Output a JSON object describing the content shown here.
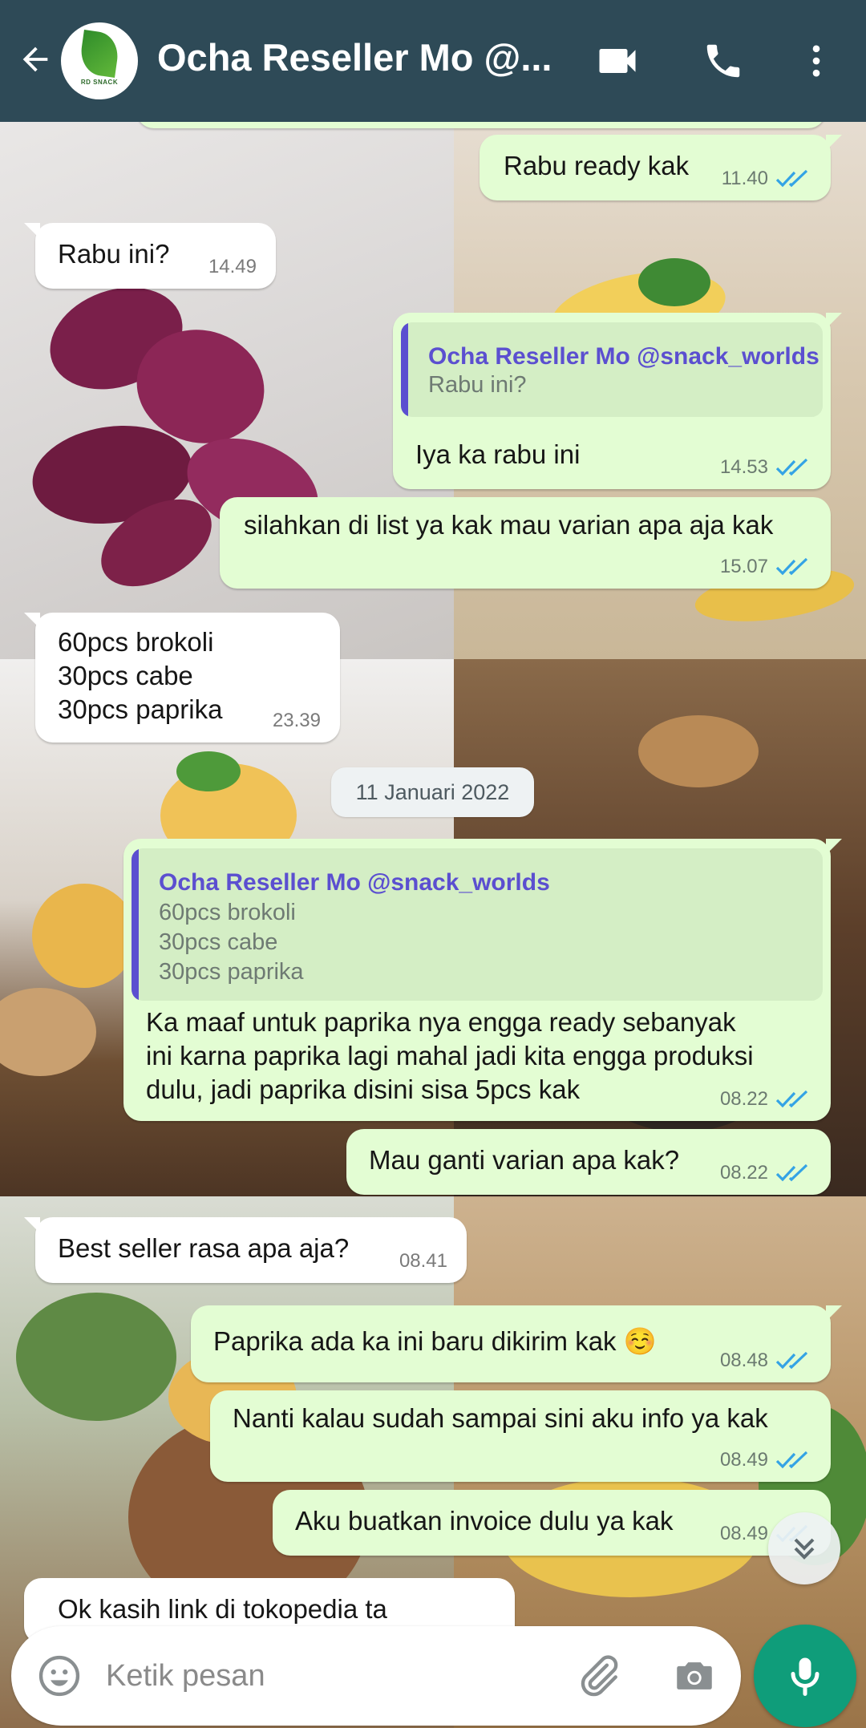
{
  "header": {
    "title": "Ocha Reseller Mo @...",
    "avatar_text": "RD SNACK"
  },
  "messages": [
    {
      "text": "Rabu ready kak",
      "time": "11.40",
      "direction": "out"
    },
    {
      "text": "Rabu ini?",
      "time": "14.49",
      "direction": "in"
    },
    {
      "quote_name": "Ocha Reseller Mo @snack_worlds",
      "quote_text": "Rabu ini?",
      "text": "Iya ka rabu ini",
      "time": "14.53",
      "direction": "out"
    },
    {
      "text": "silahkan di list ya kak mau varian apa aja kak",
      "time": "15.07",
      "direction": "out"
    },
    {
      "text": "60pcs brokoli\n30pcs cabe\n30pcs paprika",
      "time": "23.39",
      "direction": "in"
    },
    {
      "quote_name": "Ocha Reseller Mo @snack_worlds",
      "quote_text": "60pcs brokoli\n30pcs cabe\n30pcs paprika",
      "text": "Ka maaf untuk paprika nya engga ready sebanyak\nini karna paprika lagi mahal jadi kita engga produksi\ndulu, jadi paprika disini sisa 5pcs kak",
      "time": "08.22",
      "direction": "out"
    },
    {
      "text": "Mau ganti varian apa kak?",
      "time": "08.22",
      "direction": "out"
    },
    {
      "text": "Best seller rasa apa aja?",
      "time": "08.41",
      "direction": "in"
    },
    {
      "text": "Paprika ada ka ini baru dikirim kak ☺️",
      "time": "08.48",
      "direction": "out"
    },
    {
      "text": "Nanti kalau sudah sampai sini aku info ya kak",
      "time": "08.49",
      "direction": "out"
    },
    {
      "text": "Aku buatkan invoice dulu ya kak",
      "time": "08.49",
      "direction": "out"
    },
    {
      "text": "Ok kasih link di tokopedia ta",
      "time": "",
      "direction": "in"
    }
  ],
  "date_separator": "11 Januari 2022",
  "input": {
    "placeholder": "Ketik pesan"
  },
  "icons": {
    "back": "back-arrow-icon",
    "video": "video-call-icon",
    "phone": "voice-call-icon",
    "menu": "more-vert-icon",
    "emoji": "emoji-icon",
    "attach": "paperclip-icon",
    "camera": "camera-icon",
    "mic": "mic-icon",
    "scroll": "double-chevron-down-icon",
    "read": "double-check-icon"
  },
  "colors": {
    "header": "#2e4a57",
    "outgoing_bubble": "#e3fdd3",
    "incoming_bubble": "#ffffff",
    "read_ticks": "#34a3e5",
    "quote_accent": "#5b4fd0",
    "mic_button": "#0f9d7a"
  }
}
